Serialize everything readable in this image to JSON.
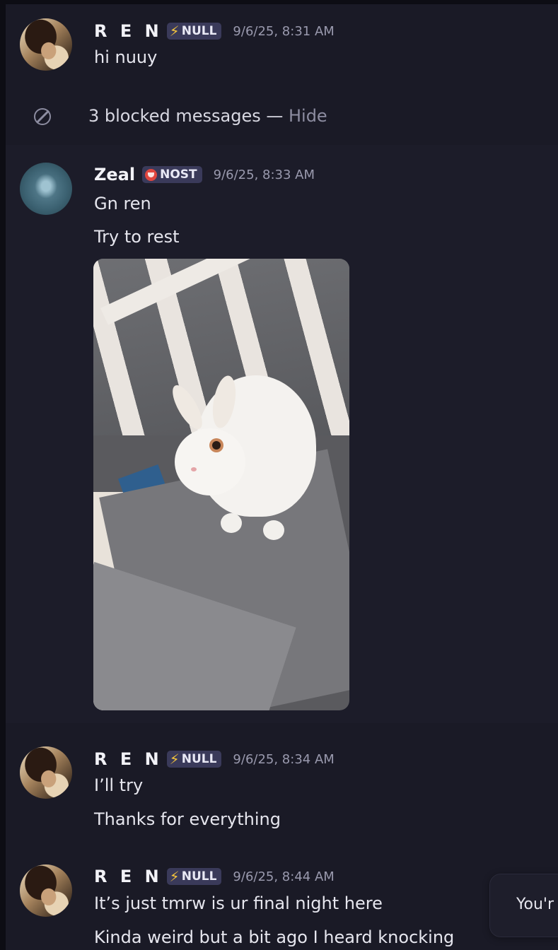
{
  "messages": [
    {
      "user": "R E N",
      "tag": "NULL",
      "tag_icon": "lightning-bolt-icon",
      "timestamp": "9/6/25, 8:31 AM",
      "lines": [
        "hi nuuy"
      ]
    },
    {
      "user": "Zeal",
      "tag": "NOST",
      "tag_icon": "red-emblem-icon",
      "timestamp": "9/6/25, 8:33 AM",
      "lines": [
        "Gn ren",
        "Try to rest"
      ],
      "attachment": "image-white-rabbit"
    },
    {
      "user": "R E N",
      "tag": "NULL",
      "tag_icon": "lightning-bolt-icon",
      "timestamp": "9/6/25, 8:34 AM",
      "lines": [
        "I’ll try",
        "Thanks for everything"
      ]
    },
    {
      "user": "R E N",
      "tag": "NULL",
      "tag_icon": "lightning-bolt-icon",
      "timestamp": "9/6/25, 8:44 AM",
      "lines": [
        "It’s just tmrw is ur final night here",
        "Kinda weird but a bit ago I heard knocking"
      ]
    }
  ],
  "blocked": {
    "text": "3 blocked messages — ",
    "action": "Hide",
    "icon": "blocked-circle-icon"
  },
  "toast": {
    "text": "You'r"
  },
  "colors": {
    "background": "#1a1a26",
    "tag_bg": "#3a3a5a",
    "bolt": "#f5c43c",
    "timestamp": "#9a9aae"
  }
}
